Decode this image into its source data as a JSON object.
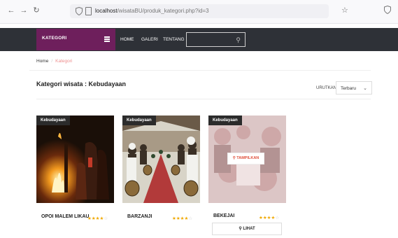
{
  "browser": {
    "url_host": "localhost",
    "url_path": "/wisataBU/produk_kategori.php?id=3"
  },
  "navbar": {
    "category_label": "KATEGORI",
    "links": [
      "HOME",
      "GALERI",
      "TENTANG"
    ]
  },
  "breadcrumb": {
    "home": "Home",
    "separator": "/",
    "current": "Kategori"
  },
  "page": {
    "title": "Kategori wisata : Kebudayaan",
    "sort_label": "URUTKAN :",
    "sort_value": "Terbaru"
  },
  "products": [
    {
      "badge": "Kebudayaan",
      "name": "OPOI MALEM LIKAU",
      "rating": 4
    },
    {
      "badge": "Kebudayaan",
      "name": "BARZANJI",
      "rating": 4
    },
    {
      "badge": "Kebudayaan",
      "name": "BEKEJAI",
      "rating": 4,
      "overlay_button": "TAMPILKAN",
      "view_button": "LIHAT"
    }
  ],
  "colors": {
    "navbar": "#2e3137",
    "category": "#6e1f5c",
    "star": "#f0a800",
    "breadcrumb_active": "#ee8f8f",
    "overlay_text": "#e0503c"
  }
}
